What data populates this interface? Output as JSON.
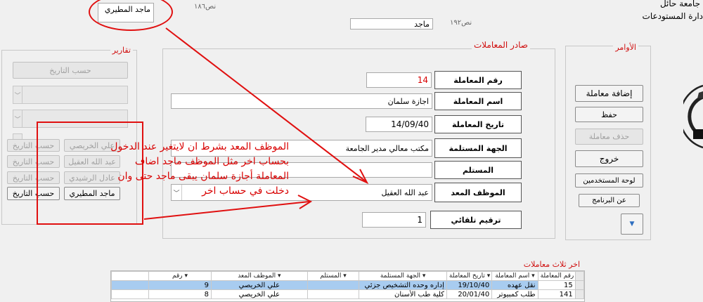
{
  "header": {
    "university": "جامعة حائل",
    "department": "دارة المستودعات",
    "text186": "نص١٨٦",
    "text192": "نص١٩٢",
    "user_box": "ماجد المطيري",
    "user_field": "ماجد"
  },
  "reports": {
    "title": "تقارير",
    "date_button": "حسب التاريخ",
    "employees": [
      {
        "name": "علي الخريصي",
        "date_label": "حسب التاريخ",
        "enabled": false
      },
      {
        "name": "عبد الله العقيل",
        "date_label": "حسب التاريخ",
        "enabled": false
      },
      {
        "name": "عادل الرشيدي",
        "date_label": "حسب التاريخ",
        "enabled": false
      },
      {
        "name": "ماجد المطيري",
        "date_label": "حسب التاريخ",
        "enabled": true
      }
    ]
  },
  "form": {
    "title": "صادر المعاملات",
    "fields": {
      "number": {
        "label": "رقم المعاملة",
        "value": "14"
      },
      "name": {
        "label": "اسم المعاملة",
        "value": "اجازة سلمان"
      },
      "date": {
        "label": "تاريخ المعاملة",
        "value": "14/09/40"
      },
      "receiver_org": {
        "label": "الجهة المستلمة",
        "value": "مكتب معالي مدير الجامعة"
      },
      "receiver": {
        "label": "المستلم",
        "value": ""
      },
      "preparer": {
        "label": "الموظف المعد",
        "value": "عبد الله العقيل"
      },
      "auto_number": {
        "label": "ترقيم تلقائي",
        "value": "1"
      }
    }
  },
  "commands": {
    "title": "الأوامر",
    "add": "إضافة معاملة",
    "save": "حفظ",
    "delete": "حذف معاملة",
    "exit": "خروج",
    "users": "لوحة المستخدمين",
    "about": "عن البرنامج"
  },
  "annotation": {
    "lines": [
      "الموظف المعد بشرط ان لايتغير عند الدخول",
      "بحساب اخر مثل الموظف ماجد اضاف",
      "المعاملة أجازة سلمان يبقى ماجد حتى وان",
      "دخلت في حساب اخر"
    ]
  },
  "last_three": {
    "title": "اخر ثلاث معاملات",
    "columns": [
      "رقم المعاملة",
      "اسم المعاملة",
      "تاريخ المعاملة",
      "الجهة المستلمة",
      "المستلم",
      "الموظف المعد",
      "رقم"
    ],
    "rows": [
      {
        "num": "15",
        "name": "نقل عهده",
        "date": "19/10/40",
        "org": "إداره وحده التشخيص جزئي",
        "receiver": "",
        "preparer": "علي الخريصي",
        "id": "9"
      },
      {
        "num": "141",
        "name": "طلب كمبيوتر",
        "date": "20/01/40",
        "org": "كلية طب الأسنان",
        "receiver": "",
        "preparer": "علي الخريصي",
        "id": "8"
      }
    ]
  },
  "colors": {
    "accent_red": "#d80000",
    "selection": "#a8ccf0"
  }
}
